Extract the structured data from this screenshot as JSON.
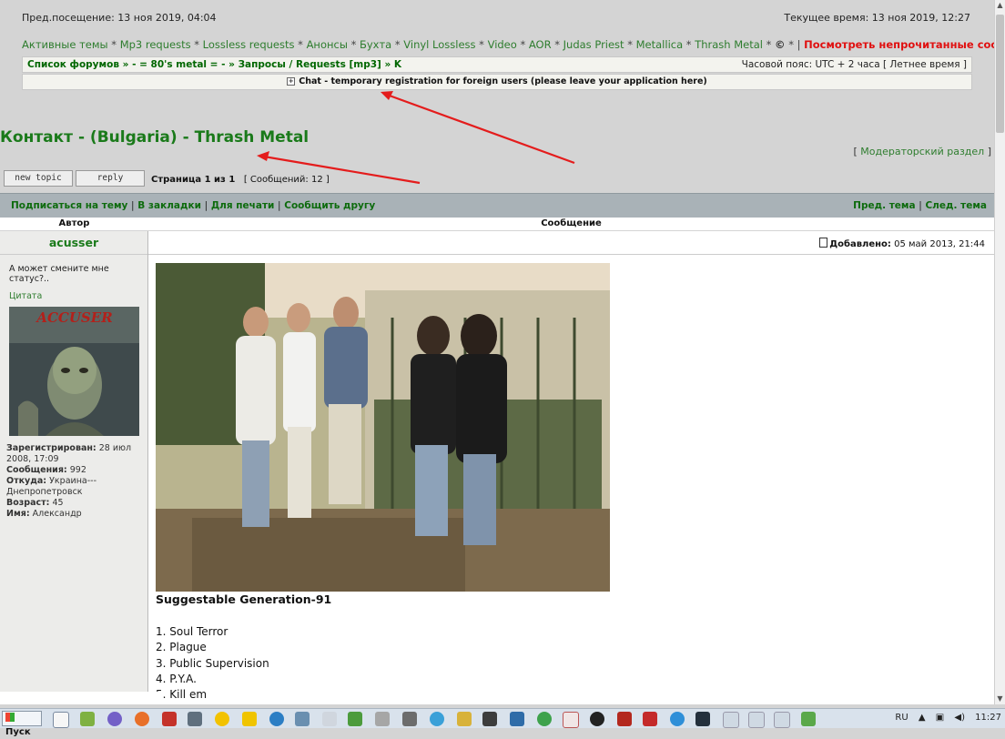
{
  "header": {
    "last_visit": "Пред.посещение: 13 ноя 2019, 04:04",
    "current_time": "Текущее время: 13 ноя 2019, 12:27"
  },
  "nav": {
    "links": [
      "Активные темы",
      "Mp3 requests",
      "Lossless requests",
      "Анонсы",
      "Бухта",
      "Vinyl Lossless",
      "Video",
      "AOR",
      "Judas Priest",
      "Metallica",
      "Thrash Metal"
    ],
    "separator": "*",
    "copyright": "©",
    "extra_sep": "*",
    "pipe": "|",
    "unread": "Посмотреть непрочитанные сообщения"
  },
  "breadcrumb": {
    "path": "Список форумов » - = 80's metal = - » Запросы / Requests [mp3] » K",
    "timezone": "Часовой пояс: UTC + 2 часа [ Летнее время ]"
  },
  "chat_notice": "Chat - temporary registration for foreign users (please leave your application here)",
  "topic": {
    "title": "Контакт - (Bulgaria) - Thrash Metal",
    "mod_open": "[ ",
    "mod_link": "Модераторский раздел",
    "mod_close": " ]"
  },
  "buttons": {
    "new_topic": "new topic",
    "reply": "reply"
  },
  "pagination": {
    "page": "Страница 1 из 1",
    "count": "[ Сообщений: 12 ]"
  },
  "actions": {
    "left": [
      "Подписаться на тему",
      "В закладки",
      "Для печати",
      "Сообщить другу"
    ],
    "right": [
      "Пред. тема",
      "След. тема"
    ],
    "pipe": "|"
  },
  "table_header": {
    "author": "Автор",
    "message": "Сообщение"
  },
  "post": {
    "author": "acusser",
    "status": "А может смените мне статус?..",
    "quote": "Цитата",
    "avatar_text": "ACCUSER",
    "profile": {
      "registered_label": "Зарегистрирован:",
      "registered": "28 июл 2008, 17:09",
      "posts_label": "Сообщения:",
      "posts": "992",
      "from_label": "Откуда:",
      "from": "Украина---Днепропетровск",
      "age_label": "Возраст:",
      "age": "45",
      "name_label": "Имя:",
      "name": "Александр"
    },
    "posted_label": "Добавлено:",
    "posted_date": "05 май 2013, 21:44",
    "heading": "Suggestable Generation-91",
    "tracks": [
      "1. Soul Terror",
      "2. Plague",
      "3. Public Supervision",
      "4. P.Y.A.",
      "5. Kill em"
    ]
  },
  "taskbar": {
    "start": "Пуск",
    "lang": "RU",
    "clock": "11:27"
  }
}
